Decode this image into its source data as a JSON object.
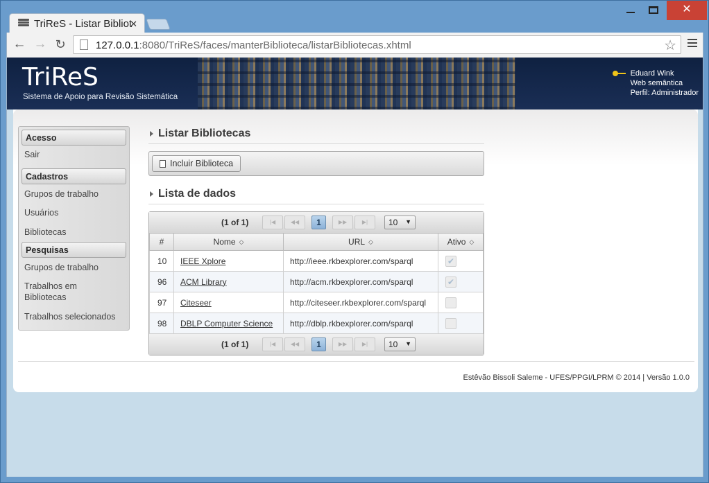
{
  "browser": {
    "tab_title": "TriReS - Listar Bibliot",
    "url_host": "127.0.0.1",
    "url_rest": ":8080/TriReS/faces/manterBiblioteca/listarBibliotecas.xhtml"
  },
  "header": {
    "logo": "TriReS",
    "subtitle": "Sistema de Apoio para Revisão Sistemática",
    "user_name": "Eduard Wink",
    "user_group": "Web semântica",
    "user_profile": "Perfil: Administrador"
  },
  "sidebar": {
    "sections": [
      {
        "title": "Acesso",
        "items": [
          "Sair"
        ]
      },
      {
        "title": "Cadastros",
        "items": [
          "Grupos de trabalho",
          "Usuários",
          "Bibliotecas"
        ]
      },
      {
        "title": "Pesquisas",
        "items": [
          "Grupos de trabalho",
          "Trabalhos em Bibliotecas",
          "Trabalhos selecionados"
        ]
      }
    ]
  },
  "main": {
    "title": "Listar Bibliotecas",
    "add_button": "Incluir Biblioteca",
    "list_title": "Lista de dados",
    "paginator": {
      "current": "(1 of 1)",
      "page": "1",
      "rows_per_page": "10"
    },
    "columns": [
      "#",
      "Nome",
      "URL",
      "Ativo"
    ],
    "rows": [
      {
        "id": "10",
        "name": "IEEE Xplore",
        "url": "http://ieee.rkbexplorer.com/sparql",
        "active": true
      },
      {
        "id": "96",
        "name": "ACM Library",
        "url": "http://acm.rkbexplorer.com/sparql",
        "active": true
      },
      {
        "id": "97",
        "name": "Citeseer",
        "url": "http://citeseer.rkbexplorer.com/sparql",
        "active": false
      },
      {
        "id": "98",
        "name": "DBLP Computer Science",
        "url": "http://dblp.rkbexplorer.com/sparql",
        "active": false
      }
    ]
  },
  "footer": {
    "text": "Estêvão Bissoli Saleme - UFES/PPGI/LPRM © 2014 | Versão 1.0.0"
  },
  "icons": {
    "favicon": "books-icon",
    "user": "key-icon",
    "add": "document-icon",
    "sort": "sort-icon",
    "check": "check-icon"
  }
}
